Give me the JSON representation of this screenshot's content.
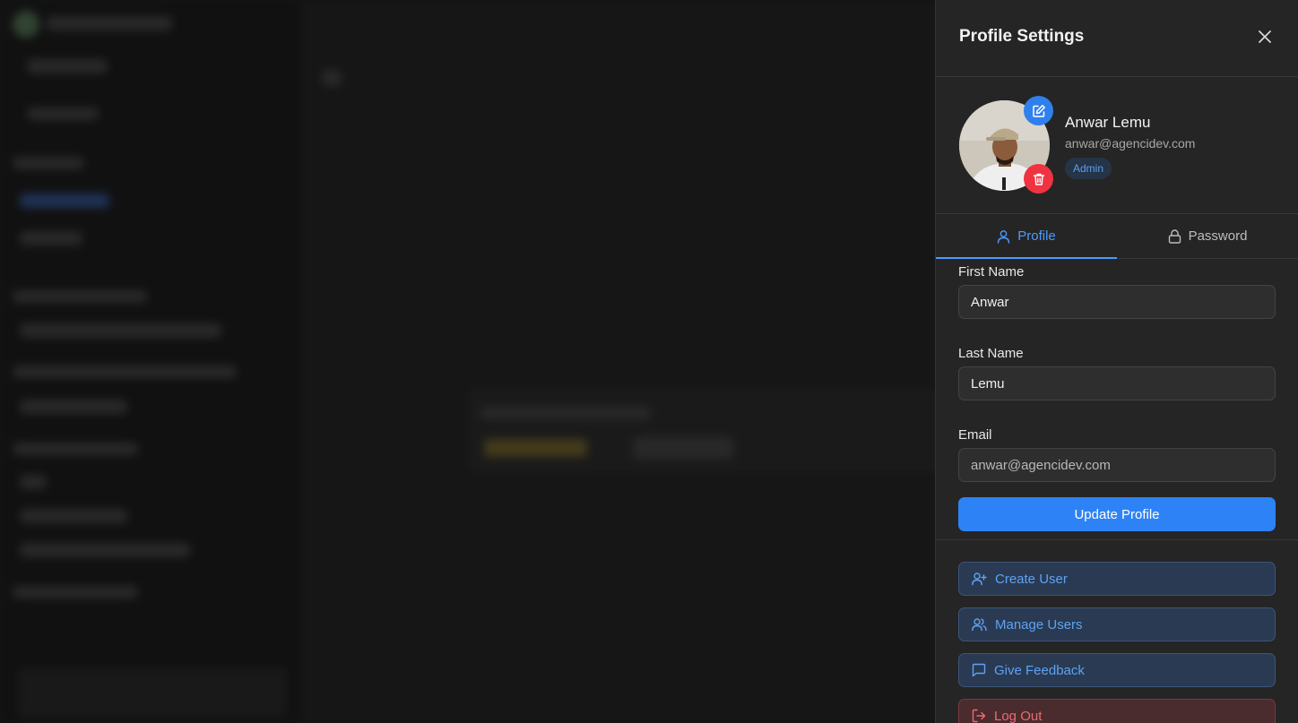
{
  "panel": {
    "title": "Profile Settings",
    "close_icon": "close-icon"
  },
  "user": {
    "name": "Anwar Lemu",
    "email": "anwar@agencidev.com",
    "role": "Admin"
  },
  "tabs": [
    {
      "label": "Profile",
      "icon": "user-icon",
      "active": true
    },
    {
      "label": "Password",
      "icon": "lock-icon",
      "active": false
    }
  ],
  "form": {
    "first_name": {
      "label": "First Name",
      "value": "Anwar"
    },
    "last_name": {
      "label": "Last Name",
      "value": "Lemu"
    },
    "email": {
      "label": "Email",
      "value": "anwar@agencidev.com"
    },
    "submit_label": "Update Profile"
  },
  "actions": [
    {
      "label": "Create User",
      "icon": "user-plus-icon"
    },
    {
      "label": "Manage Users",
      "icon": "users-icon"
    },
    {
      "label": "Give Feedback",
      "icon": "message-square-icon"
    },
    {
      "label": "Log Out",
      "icon": "log-out-icon"
    }
  ],
  "colors": {
    "accent": "#2d83f5",
    "danger": "#ef3340",
    "panel_bg": "#252525"
  }
}
